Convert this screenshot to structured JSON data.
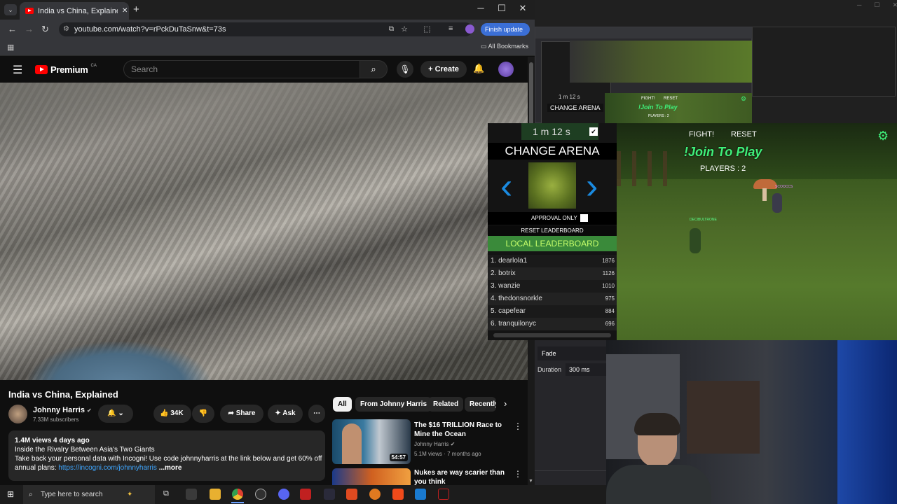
{
  "browser": {
    "tab_title": "India vs China, Explained - You",
    "new_tab": "+",
    "url": "youtube.com/watch?v=rPckDuTaSnw&t=73s",
    "finish_update": "Finish update",
    "bookmarks_label": "All Bookmarks",
    "minimize": "─",
    "maximize": "☐",
    "close": "✕"
  },
  "youtube": {
    "brand": "Premium",
    "region": "CA",
    "search_placeholder": "Search",
    "create_label": "Create",
    "video_title": "India vs China, Explained",
    "channel_name": "Johnny Harris",
    "subscribers": "7.33M subscribers",
    "likes": "34K",
    "share_label": "Share",
    "ask_label": "Ask",
    "description": {
      "stats": "1.4M views  4 days ago",
      "line1": "Inside the Rivalry Between Asia's Two Giants",
      "line2": "Take back your personal data with Incogni! Use code johnnyharris at the link below and get 60% off",
      "line3_prefix": "annual plans: ",
      "line3_link": "https://incogni.com/johnnyharris",
      "more": "...more"
    },
    "chips": [
      "All",
      "From Johnny Harris",
      "Related",
      "Recently"
    ],
    "recommendations": [
      {
        "title": "The $16 TRILLION Race to Mine the Ocean",
        "channel": "Johnny Harris",
        "meta": "5.1M views · 7 months ago",
        "duration": "54:57"
      },
      {
        "title": "Nukes are way scarier than you think",
        "channel": "",
        "meta": "",
        "duration": ""
      }
    ]
  },
  "game_panel": {
    "timer": "1 m 12 s",
    "change_arena": "CHANGE ARENA",
    "approval_only": "APPROVAL ONLY",
    "reset_leaderboard": "RESET LEADERBOARD",
    "local_leaderboard": "LOCAL LEADERBOARD",
    "leaderboard": [
      {
        "rank": "1.",
        "name": "dearlola1",
        "score": "1876"
      },
      {
        "rank": "2.",
        "name": "botrix",
        "score": "1126"
      },
      {
        "rank": "3.",
        "name": "wanzie",
        "score": "1010"
      },
      {
        "rank": "4.",
        "name": "thedonsnorkle",
        "score": "975"
      },
      {
        "rank": "5.",
        "name": "capefear",
        "score": "884"
      },
      {
        "rank": "6.",
        "name": "tranquilonyc",
        "score": "696"
      }
    ]
  },
  "game": {
    "fight": "FIGHT!",
    "reset": "RESET",
    "join": "!Join To Play",
    "players": "PLAYERS : 2",
    "player1": "DECIBULTRONE",
    "player2": "SCOOCCS"
  },
  "mirror": {
    "timer": "1 m 12 s",
    "change_arena": "CHANGE ARENA",
    "fight": "FIGHT!",
    "reset": "RESET",
    "join": "!Join To Play",
    "players": "PLAYERS : 2"
  },
  "obs": {
    "transition": "Fade",
    "duration_label": "Duration",
    "duration_value": "300 ms"
  },
  "taskbar": {
    "search_placeholder": "Type here to search"
  }
}
